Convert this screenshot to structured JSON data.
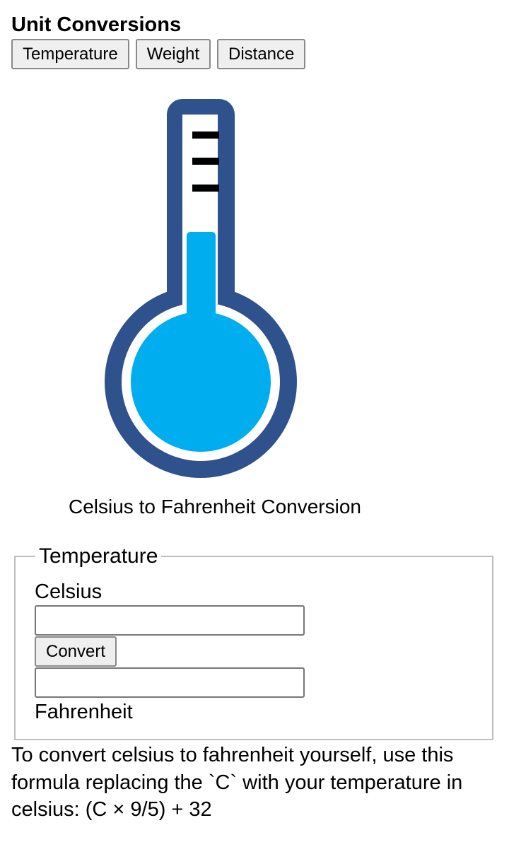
{
  "app": {
    "title": "Unit Conversions"
  },
  "tabs": [
    {
      "label": "Temperature"
    },
    {
      "label": "Weight"
    },
    {
      "label": "Distance"
    }
  ],
  "illustration": {
    "icon": "thermometer-icon",
    "colors": {
      "outline": "#30528c",
      "mercury": "#00aeef",
      "ticks": "#000000"
    }
  },
  "converter": {
    "caption": "Celsius to Fahrenheit Conversion",
    "legend": "Temperature",
    "input_label": "Celsius",
    "input_value": "",
    "button_label": "Convert",
    "output_value": "",
    "output_label": "Fahrenheit"
  },
  "help": {
    "formula_text": "To convert celsius to fahrenheit yourself, use this formula replacing the `C` with your temperature in celsius: (C × 9/5) + 32"
  }
}
